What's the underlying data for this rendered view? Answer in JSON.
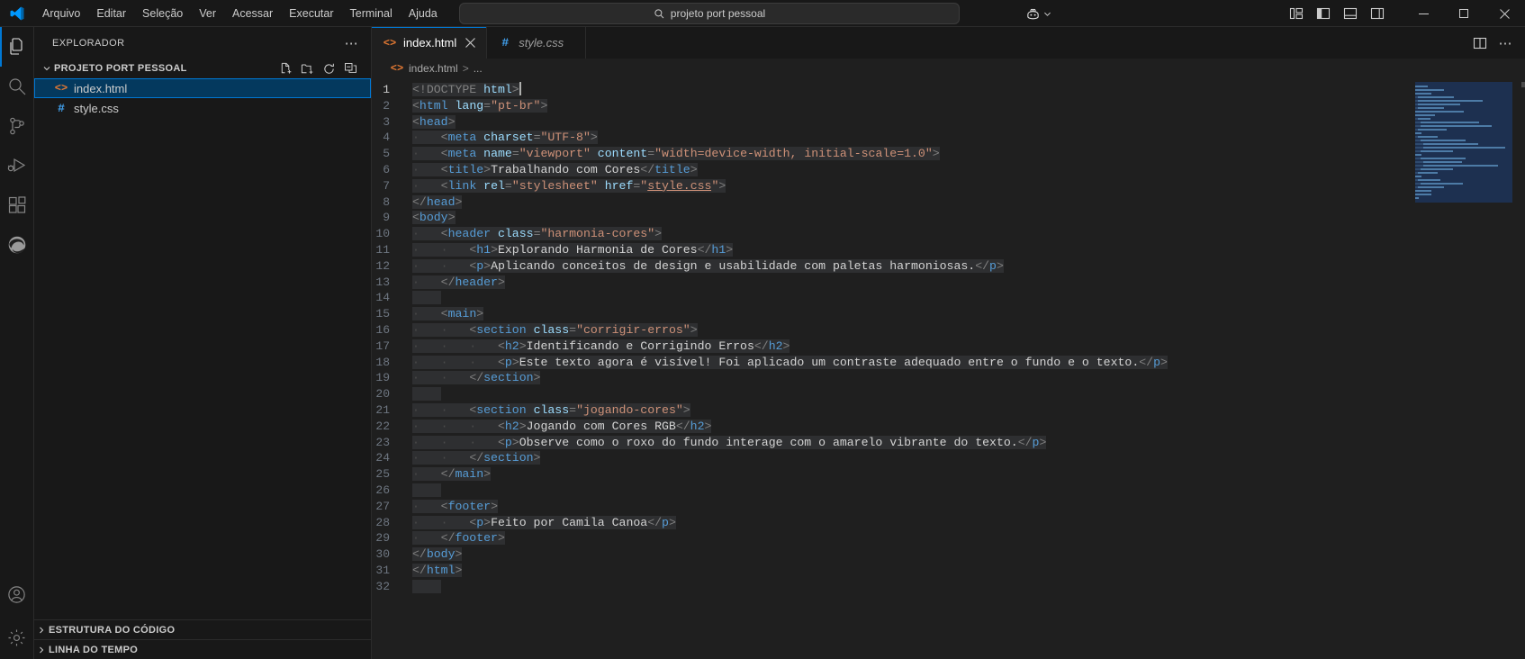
{
  "titlebar": {
    "logo_icon": "vscode-logo-icon",
    "menu": [
      {
        "label": "Arquivo"
      },
      {
        "label": "Editar"
      },
      {
        "label": "Seleção"
      },
      {
        "label": "Ver"
      },
      {
        "label": "Acessar"
      },
      {
        "label": "Executar"
      },
      {
        "label": "Terminal"
      },
      {
        "label": "Ajuda"
      }
    ],
    "nav": {
      "back_icon": "arrow-left-icon",
      "forward_icon": "arrow-right-icon"
    },
    "command_center": {
      "search_icon": "search-icon",
      "value": "projeto port pessoal",
      "placeholder": "projeto port pessoal"
    },
    "copilot": {
      "icon": "copilot-icon",
      "chevron": "chevron-down-icon"
    },
    "layout_actions": [
      {
        "name": "customize-layout-icon",
        "title": "Personalizar Layout"
      },
      {
        "name": "toggle-primary-sidebar-icon",
        "title": "Alternar Barra Lateral Primária"
      },
      {
        "name": "toggle-panel-icon",
        "title": "Alternar Painel"
      },
      {
        "name": "toggle-secondary-sidebar-icon",
        "title": "Alternar Barra Lateral Secundária"
      }
    ],
    "window_controls": {
      "minimize": "—",
      "maximize": "□",
      "close": "✕"
    }
  },
  "activitybar": {
    "items": [
      {
        "name": "explorer",
        "icon": "files-icon",
        "active": true
      },
      {
        "name": "search",
        "icon": "search-icon",
        "active": false
      },
      {
        "name": "source-control",
        "icon": "source-control-icon",
        "active": false
      },
      {
        "name": "run-debug",
        "icon": "run-and-debug-icon",
        "active": false
      },
      {
        "name": "extensions",
        "icon": "extensions-icon",
        "active": false
      },
      {
        "name": "browser-preview",
        "icon": "edge-browser-icon",
        "active": false
      }
    ],
    "bottom": [
      {
        "name": "accounts",
        "icon": "account-icon"
      },
      {
        "name": "manage",
        "icon": "gear-icon"
      }
    ]
  },
  "sidebar": {
    "title": "EXPLORADOR",
    "more_actions_icon": "ellipsis-icon",
    "folder": {
      "name": "PROJETO PORT PESSOAL",
      "chevron": "chevron-down-icon",
      "actions": [
        {
          "name": "new-file-icon"
        },
        {
          "name": "new-folder-icon"
        },
        {
          "name": "refresh-icon"
        },
        {
          "name": "collapse-all-icon"
        }
      ]
    },
    "files": [
      {
        "name": "index.html",
        "icon": "html-file-icon",
        "selected": true
      },
      {
        "name": "style.css",
        "icon": "css-file-icon",
        "selected": false
      }
    ],
    "collapsed_sections": [
      {
        "label": "ESTRUTURA DO CÓDIGO",
        "chevron": "chevron-right-icon"
      },
      {
        "label": "LINHA DO TEMPO",
        "chevron": "chevron-right-icon"
      }
    ]
  },
  "editor": {
    "tabs": [
      {
        "label": "index.html",
        "icon": "html-file-icon",
        "active": true,
        "preview": false,
        "close_icon": "close-icon"
      },
      {
        "label": "style.css",
        "icon": "css-file-icon",
        "active": false,
        "preview": true,
        "close_icon": "close-icon"
      }
    ],
    "tabbar_actions": [
      {
        "name": "split-editor-right-icon"
      },
      {
        "name": "more-actions-icon"
      }
    ],
    "breadcrumb": {
      "file_icon": "html-file-icon",
      "file": "index.html",
      "separator": ">",
      "more": "..."
    },
    "cursor_line": 1,
    "total_lines": 32,
    "code_lines": [
      {
        "n": 1,
        "indent": 0,
        "tokens": [
          {
            "t": "pn",
            "v": "<!DOCTYPE "
          },
          {
            "t": "at",
            "v": "html"
          },
          {
            "t": "pn",
            "v": ">"
          }
        ]
      },
      {
        "n": 2,
        "indent": 0,
        "tokens": [
          {
            "t": "pn",
            "v": "<"
          },
          {
            "t": "tg",
            "v": "html"
          },
          {
            "t": "tx",
            "v": " "
          },
          {
            "t": "at",
            "v": "lang"
          },
          {
            "t": "pn",
            "v": "="
          },
          {
            "t": "st",
            "v": "\"pt-br\""
          },
          {
            "t": "pn",
            "v": ">"
          }
        ]
      },
      {
        "n": 3,
        "indent": 0,
        "tokens": [
          {
            "t": "pn",
            "v": "<"
          },
          {
            "t": "tg",
            "v": "head"
          },
          {
            "t": "pn",
            "v": ">"
          }
        ]
      },
      {
        "n": 4,
        "indent": 1,
        "tokens": [
          {
            "t": "pn",
            "v": "<"
          },
          {
            "t": "tg",
            "v": "meta"
          },
          {
            "t": "tx",
            "v": " "
          },
          {
            "t": "at",
            "v": "charset"
          },
          {
            "t": "pn",
            "v": "="
          },
          {
            "t": "st",
            "v": "\"UTF-8\""
          },
          {
            "t": "pn",
            "v": ">"
          }
        ]
      },
      {
        "n": 5,
        "indent": 1,
        "tokens": [
          {
            "t": "pn",
            "v": "<"
          },
          {
            "t": "tg",
            "v": "meta"
          },
          {
            "t": "tx",
            "v": " "
          },
          {
            "t": "at",
            "v": "name"
          },
          {
            "t": "pn",
            "v": "="
          },
          {
            "t": "st",
            "v": "\"viewport\""
          },
          {
            "t": "tx",
            "v": " "
          },
          {
            "t": "at",
            "v": "content"
          },
          {
            "t": "pn",
            "v": "="
          },
          {
            "t": "st",
            "v": "\"width=device-width, initial-scale=1.0\""
          },
          {
            "t": "pn",
            "v": ">"
          }
        ]
      },
      {
        "n": 6,
        "indent": 1,
        "tokens": [
          {
            "t": "pn",
            "v": "<"
          },
          {
            "t": "tg",
            "v": "title"
          },
          {
            "t": "pn",
            "v": ">"
          },
          {
            "t": "tx",
            "v": "Trabalhando com Cores"
          },
          {
            "t": "pn",
            "v": "</"
          },
          {
            "t": "tg",
            "v": "title"
          },
          {
            "t": "pn",
            "v": ">"
          }
        ]
      },
      {
        "n": 7,
        "indent": 1,
        "tokens": [
          {
            "t": "pn",
            "v": "<"
          },
          {
            "t": "tg",
            "v": "link"
          },
          {
            "t": "tx",
            "v": " "
          },
          {
            "t": "at",
            "v": "rel"
          },
          {
            "t": "pn",
            "v": "="
          },
          {
            "t": "st",
            "v": "\"stylesheet\""
          },
          {
            "t": "tx",
            "v": " "
          },
          {
            "t": "at",
            "v": "href"
          },
          {
            "t": "pn",
            "v": "="
          },
          {
            "t": "st",
            "v": "\""
          },
          {
            "t": "lnk",
            "v": "style.css"
          },
          {
            "t": "st",
            "v": "\""
          },
          {
            "t": "pn",
            "v": ">"
          }
        ]
      },
      {
        "n": 8,
        "indent": 0,
        "tokens": [
          {
            "t": "pn",
            "v": "</"
          },
          {
            "t": "tg",
            "v": "head"
          },
          {
            "t": "pn",
            "v": ">"
          }
        ]
      },
      {
        "n": 9,
        "indent": 0,
        "tokens": [
          {
            "t": "pn",
            "v": "<"
          },
          {
            "t": "tg",
            "v": "body"
          },
          {
            "t": "pn",
            "v": ">"
          }
        ]
      },
      {
        "n": 10,
        "indent": 1,
        "tokens": [
          {
            "t": "pn",
            "v": "<"
          },
          {
            "t": "tg",
            "v": "header"
          },
          {
            "t": "tx",
            "v": " "
          },
          {
            "t": "at",
            "v": "class"
          },
          {
            "t": "pn",
            "v": "="
          },
          {
            "t": "st",
            "v": "\"harmonia-cores\""
          },
          {
            "t": "pn",
            "v": ">"
          }
        ]
      },
      {
        "n": 11,
        "indent": 2,
        "tokens": [
          {
            "t": "pn",
            "v": "<"
          },
          {
            "t": "tg",
            "v": "h1"
          },
          {
            "t": "pn",
            "v": ">"
          },
          {
            "t": "tx",
            "v": "Explorando Harmonia de Cores"
          },
          {
            "t": "pn",
            "v": "</"
          },
          {
            "t": "tg",
            "v": "h1"
          },
          {
            "t": "pn",
            "v": ">"
          }
        ]
      },
      {
        "n": 12,
        "indent": 2,
        "tokens": [
          {
            "t": "pn",
            "v": "<"
          },
          {
            "t": "tg",
            "v": "p"
          },
          {
            "t": "pn",
            "v": ">"
          },
          {
            "t": "tx",
            "v": "Aplicando conceitos de design e usabilidade com paletas harmoniosas."
          },
          {
            "t": "pn",
            "v": "</"
          },
          {
            "t": "tg",
            "v": "p"
          },
          {
            "t": "pn",
            "v": ">"
          }
        ]
      },
      {
        "n": 13,
        "indent": 1,
        "tokens": [
          {
            "t": "pn",
            "v": "</"
          },
          {
            "t": "tg",
            "v": "header"
          },
          {
            "t": "pn",
            "v": ">"
          }
        ]
      },
      {
        "n": 14,
        "indent": 0,
        "tokens": []
      },
      {
        "n": 15,
        "indent": 1,
        "tokens": [
          {
            "t": "pn",
            "v": "<"
          },
          {
            "t": "tg",
            "v": "main"
          },
          {
            "t": "pn",
            "v": ">"
          }
        ]
      },
      {
        "n": 16,
        "indent": 2,
        "tokens": [
          {
            "t": "pn",
            "v": "<"
          },
          {
            "t": "tg",
            "v": "section"
          },
          {
            "t": "tx",
            "v": " "
          },
          {
            "t": "at",
            "v": "class"
          },
          {
            "t": "pn",
            "v": "="
          },
          {
            "t": "st",
            "v": "\"corrigir-erros\""
          },
          {
            "t": "pn",
            "v": ">"
          }
        ]
      },
      {
        "n": 17,
        "indent": 3,
        "tokens": [
          {
            "t": "pn",
            "v": "<"
          },
          {
            "t": "tg",
            "v": "h2"
          },
          {
            "t": "pn",
            "v": ">"
          },
          {
            "t": "tx",
            "v": "Identificando e Corrigindo Erros"
          },
          {
            "t": "pn",
            "v": "</"
          },
          {
            "t": "tg",
            "v": "h2"
          },
          {
            "t": "pn",
            "v": ">"
          }
        ]
      },
      {
        "n": 18,
        "indent": 3,
        "tokens": [
          {
            "t": "pn",
            "v": "<"
          },
          {
            "t": "tg",
            "v": "p"
          },
          {
            "t": "pn",
            "v": ">"
          },
          {
            "t": "tx",
            "v": "Este texto agora é visível! Foi aplicado um contraste adequado entre o fundo e o texto."
          },
          {
            "t": "pn",
            "v": "</"
          },
          {
            "t": "tg",
            "v": "p"
          },
          {
            "t": "pn",
            "v": ">"
          }
        ]
      },
      {
        "n": 19,
        "indent": 2,
        "tokens": [
          {
            "t": "pn",
            "v": "</"
          },
          {
            "t": "tg",
            "v": "section"
          },
          {
            "t": "pn",
            "v": ">"
          }
        ]
      },
      {
        "n": 20,
        "indent": 0,
        "tokens": []
      },
      {
        "n": 21,
        "indent": 2,
        "tokens": [
          {
            "t": "pn",
            "v": "<"
          },
          {
            "t": "tg",
            "v": "section"
          },
          {
            "t": "tx",
            "v": " "
          },
          {
            "t": "at",
            "v": "class"
          },
          {
            "t": "pn",
            "v": "="
          },
          {
            "t": "st",
            "v": "\"jogando-cores\""
          },
          {
            "t": "pn",
            "v": ">"
          }
        ]
      },
      {
        "n": 22,
        "indent": 3,
        "tokens": [
          {
            "t": "pn",
            "v": "<"
          },
          {
            "t": "tg",
            "v": "h2"
          },
          {
            "t": "pn",
            "v": ">"
          },
          {
            "t": "tx",
            "v": "Jogando com Cores RGB"
          },
          {
            "t": "pn",
            "v": "</"
          },
          {
            "t": "tg",
            "v": "h2"
          },
          {
            "t": "pn",
            "v": ">"
          }
        ]
      },
      {
        "n": 23,
        "indent": 3,
        "tokens": [
          {
            "t": "pn",
            "v": "<"
          },
          {
            "t": "tg",
            "v": "p"
          },
          {
            "t": "pn",
            "v": ">"
          },
          {
            "t": "tx",
            "v": "Observe como o roxo do fundo interage com o amarelo vibrante do texto."
          },
          {
            "t": "pn",
            "v": "</"
          },
          {
            "t": "tg",
            "v": "p"
          },
          {
            "t": "pn",
            "v": ">"
          }
        ]
      },
      {
        "n": 24,
        "indent": 2,
        "tokens": [
          {
            "t": "pn",
            "v": "</"
          },
          {
            "t": "tg",
            "v": "section"
          },
          {
            "t": "pn",
            "v": ">"
          }
        ]
      },
      {
        "n": 25,
        "indent": 1,
        "tokens": [
          {
            "t": "pn",
            "v": "</"
          },
          {
            "t": "tg",
            "v": "main"
          },
          {
            "t": "pn",
            "v": ">"
          }
        ]
      },
      {
        "n": 26,
        "indent": 0,
        "tokens": []
      },
      {
        "n": 27,
        "indent": 1,
        "tokens": [
          {
            "t": "pn",
            "v": "<"
          },
          {
            "t": "tg",
            "v": "footer"
          },
          {
            "t": "pn",
            "v": ">"
          }
        ]
      },
      {
        "n": 28,
        "indent": 2,
        "tokens": [
          {
            "t": "pn",
            "v": "<"
          },
          {
            "t": "tg",
            "v": "p"
          },
          {
            "t": "pn",
            "v": ">"
          },
          {
            "t": "tx",
            "v": "Feito por Camila Canoa"
          },
          {
            "t": "pn",
            "v": "</"
          },
          {
            "t": "tg",
            "v": "p"
          },
          {
            "t": "pn",
            "v": ">"
          }
        ]
      },
      {
        "n": 29,
        "indent": 1,
        "tokens": [
          {
            "t": "pn",
            "v": "</"
          },
          {
            "t": "tg",
            "v": "footer"
          },
          {
            "t": "pn",
            "v": ">"
          }
        ]
      },
      {
        "n": 30,
        "indent": 0,
        "tokens": [
          {
            "t": "pn",
            "v": "</"
          },
          {
            "t": "tg",
            "v": "body"
          },
          {
            "t": "pn",
            "v": ">"
          }
        ]
      },
      {
        "n": 31,
        "indent": 0,
        "tokens": [
          {
            "t": "pn",
            "v": "</"
          },
          {
            "t": "tg",
            "v": "html"
          },
          {
            "t": "pn",
            "v": ">"
          }
        ]
      },
      {
        "n": 32,
        "indent": 0,
        "tokens": []
      }
    ],
    "minimap": {
      "rows": [
        4,
        9,
        5,
        11,
        20,
        13,
        8,
        15,
        6,
        4,
        18,
        22,
        9,
        2,
        6,
        14,
        17,
        26,
        10,
        2,
        14,
        12,
        23,
        10,
        6,
        2,
        7,
        13,
        8,
        5,
        5,
        1
      ]
    }
  },
  "colors": {
    "accent": "#0078d4",
    "selection_bg": "#04395e",
    "editor_bg": "#1f1f1f",
    "chrome_bg": "#181818",
    "tag": "#569cd6",
    "attribute": "#9cdcfe",
    "string": "#ce9178",
    "text": "#d4d4d4",
    "punctuation": "#808080",
    "html_icon": "#e37933",
    "css_icon": "#42a5f5"
  }
}
